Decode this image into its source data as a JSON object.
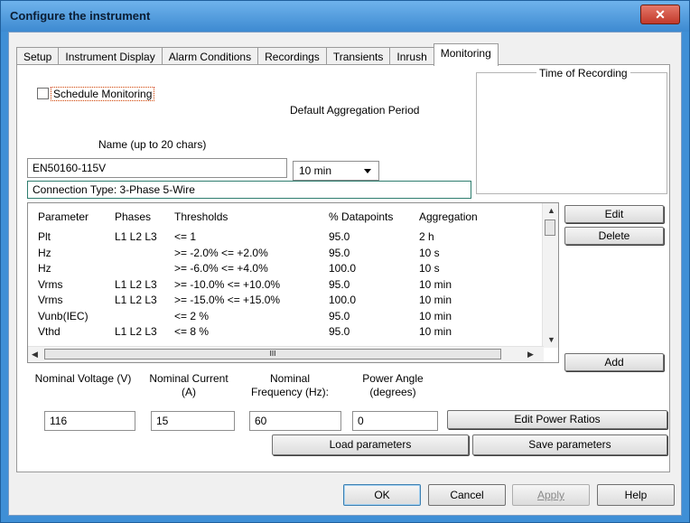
{
  "window": {
    "title": "Configure the instrument",
    "close_glyph": "✕"
  },
  "tabs": [
    {
      "label": "Setup"
    },
    {
      "label": "Instrument Display"
    },
    {
      "label": "Alarm Conditions"
    },
    {
      "label": "Recordings"
    },
    {
      "label": "Transients"
    },
    {
      "label": "Inrush"
    },
    {
      "label": "Monitoring"
    }
  ],
  "active_tab": "Monitoring",
  "monitoring": {
    "schedule_label": "Schedule Monitoring",
    "schedule_checked": false,
    "default_aggregation_label": "Default Aggregation Period",
    "name_label": "Name (up to 20 chars)",
    "name_value": "EN50160-115V",
    "aggregation_value": "10 min",
    "connection_type": "Connection Type: 3-Phase 5-Wire",
    "time_of_recording_label": "Time of Recording"
  },
  "parameter_list": {
    "columns": [
      "Parameter",
      "Phases",
      "Thresholds",
      "% Datapoints",
      "Aggregation"
    ],
    "rows": [
      {
        "parameter": "Plt",
        "phases": "L1 L2 L3",
        "thresholds": "<= 1",
        "datapoints": "95.0",
        "aggregation": "2 h"
      },
      {
        "parameter": "Hz",
        "phases": "",
        "thresholds": ">= -2.0% <= +2.0%",
        "datapoints": "95.0",
        "aggregation": "10 s"
      },
      {
        "parameter": "Hz",
        "phases": "",
        "thresholds": ">= -6.0% <= +4.0%",
        "datapoints": "100.0",
        "aggregation": "10 s"
      },
      {
        "parameter": "Vrms",
        "phases": "L1 L2 L3",
        "thresholds": ">= -10.0% <= +10.0%",
        "datapoints": "95.0",
        "aggregation": "10 min"
      },
      {
        "parameter": "Vrms",
        "phases": "L1 L2 L3",
        "thresholds": ">= -15.0% <= +15.0%",
        "datapoints": "100.0",
        "aggregation": "10 min"
      },
      {
        "parameter": "Vunb(IEC)",
        "phases": "",
        "thresholds": "<= 2 %",
        "datapoints": "95.0",
        "aggregation": "10 min"
      },
      {
        "parameter": "Vthd",
        "phases": "L1 L2 L3",
        "thresholds": "<= 8 %",
        "datapoints": "95.0",
        "aggregation": "10 min"
      }
    ],
    "hscroll_grip": "III"
  },
  "list_buttons": {
    "edit": "Edit",
    "delete": "Delete",
    "add": "Add"
  },
  "nominal": {
    "voltage_label": "Nominal Voltage (V)",
    "current_label": "Nominal Current (A)",
    "frequency_label": "Nominal Frequency (Hz):",
    "power_angle_label": "Power Angle (degrees)",
    "voltage_value": "116",
    "current_value": "15",
    "frequency_value": "60",
    "power_angle_value": "0"
  },
  "param_buttons": {
    "edit_power_ratios": "Edit Power Ratios",
    "load_parameters": "Load parameters",
    "save_parameters": "Save parameters"
  },
  "dialog_buttons": {
    "ok": "OK",
    "cancel": "Cancel",
    "apply": "Apply",
    "help": "Help"
  },
  "colors": {
    "title_bar": "#3d8ad1",
    "close_button": "#c2392a",
    "panel": "#ffffff",
    "client": "#f0f0f0"
  }
}
